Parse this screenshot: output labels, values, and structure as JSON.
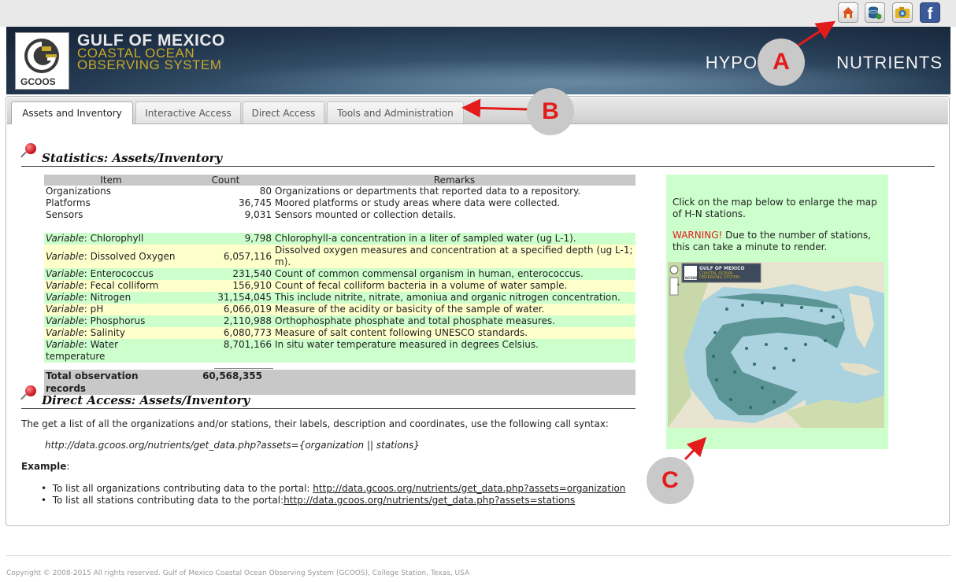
{
  "header": {
    "logo_line1": "GULF OF MEXICO",
    "logo_line2": "COASTAL OCEAN",
    "logo_line3": "OBSERVING SYSTEM",
    "logo_badge": "GCOOS",
    "section_title": "HYPOXIA & NUTRIENTS",
    "section_title_left": "HYPO",
    "section_title_right": "NUTRIENTS",
    "icons": [
      "home-icon",
      "database-icon",
      "camera-icon",
      "facebook-icon"
    ]
  },
  "tabs": [
    {
      "label": "Assets and Inventory",
      "active": true
    },
    {
      "label": "Interactive Access",
      "active": false
    },
    {
      "label": "Direct Access",
      "active": false
    },
    {
      "label": "Tools and Administration",
      "active": false
    }
  ],
  "stats": {
    "title": "Statistics: Assets/Inventory",
    "columns": [
      "Item",
      "Count",
      "Remarks"
    ],
    "rows": [
      {
        "prefix": "",
        "item": "Organizations",
        "count": "80",
        "remarks": "Organizations or departments that reported data to a repository."
      },
      {
        "prefix": "",
        "item": "Platforms",
        "count": "36,745",
        "remarks": "Moored platforms or study areas where data were collected."
      },
      {
        "prefix": "",
        "item": "Sensors",
        "count": "9,031",
        "remarks": "Sensors mounted or collection details."
      }
    ],
    "variable_prefix": "Variable",
    "variables": [
      {
        "item": ": Chlorophyll",
        "count": "9,798",
        "remarks": "Chlorophyll-a concentration in a liter of sampled water (ug L-1)."
      },
      {
        "item": ": Dissolved Oxygen",
        "count": "6,057,116",
        "remarks": "Dissolved oxygen measures and concentration at a specified depth (ug L-1; m)."
      },
      {
        "item": ": Enterococcus",
        "count": "231,540",
        "remarks": "Count of common commensal organism in human, enterococcus."
      },
      {
        "item": ": Fecal colliform",
        "count": "156,910",
        "remarks": "Count of fecal colliform bacteria in a volume of water sample."
      },
      {
        "item": ": Nitrogen",
        "count": "31,154,045",
        "remarks": "This include nitrite, nitrate, amoniua and organic nitrogen concentration."
      },
      {
        "item": ": pH",
        "count": "6,066,019",
        "remarks": "Measure of the acidity or basicity of the sample of water."
      },
      {
        "item": ": Phosphorus",
        "count": "2,110,988",
        "remarks": "Orthophosphate phosphate and total phosphate measures."
      },
      {
        "item": ": Salinity",
        "count": "6,080,773",
        "remarks": "Measure of salt content following UNESCO standards."
      },
      {
        "item": ": Water temperature",
        "count": "8,701,166",
        "remarks": "In situ water temperature measured in degrees Celsius."
      }
    ],
    "total_label": "Total observation records",
    "total_value": "60,568,355"
  },
  "side_panel": {
    "text": "Click on the map below to enlarge the map of H-N stations.",
    "warning_label": "WARNING!",
    "warning_text": " Due to the number of stations, this can take a minute to render.",
    "map_badge": "GCOOS",
    "map_logo_line1": "GULF OF MEXICO",
    "map_logo_line2": "COASTAL OCEAN",
    "map_logo_line3": "OBSERVING SYSTEM"
  },
  "direct": {
    "title": "Direct Access: Assets/Inventory",
    "intro": "The get a list of all the organizations and/or stations, their labels, description and coordinates, use the following call syntax:",
    "syntax": "http://data.gcoos.org/nutrients/get_data.php?assets={organization || stations}",
    "example_label": "Example",
    "example_colon": ":",
    "examples": [
      {
        "text": "To list all organizations contributing data to the portal: ",
        "link": "http://data.gcoos.org/nutrients/get_data.php?assets=organization"
      },
      {
        "text": "To list all stations contributing data to the portal:",
        "link": "http://data.gcoos.org/nutrients/get_data.php?assets=stations"
      }
    ]
  },
  "markers": [
    "A",
    "B",
    "C"
  ],
  "footer": "Copyright © 2008-2015 All rights reserved. Gulf of Mexico Coastal Ocean Observing System (GCOOS), College Station, Texas, USA",
  "colors": {
    "green_row": "#ccffcc",
    "yellow_row": "#ffffcc",
    "warning": "#e31b1b",
    "marker_text": "#e31b1b"
  }
}
